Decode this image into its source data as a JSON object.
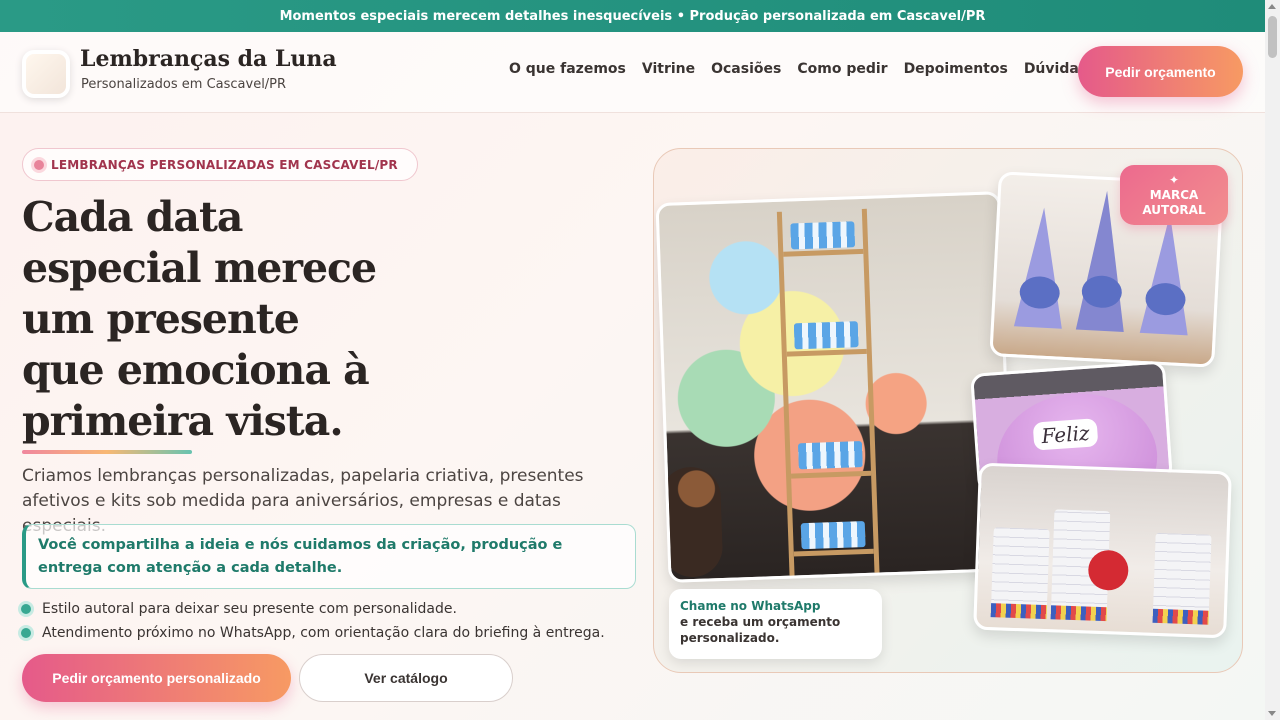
{
  "topbar": {
    "text": "Momentos especiais merecem detalhes inesquecíveis • Produção personalizada em Cascavel/PR"
  },
  "brand": {
    "name": "Lembranças da Luna",
    "subtitle": "Personalizados em Cascavel/PR"
  },
  "nav": {
    "items": [
      {
        "label": "O que fazemos"
      },
      {
        "label": "Vitrine"
      },
      {
        "label": "Ocasiões"
      },
      {
        "label": "Como pedir"
      },
      {
        "label": "Depoimentos"
      },
      {
        "label": "Dúvidas"
      }
    ],
    "cta_label": "Pedir orçamento"
  },
  "hero": {
    "pill_label": "LEMBRANÇAS PERSONALIZADAS EM CASCAVEL/PR",
    "headline_lines": [
      "Cada data",
      "especial merece",
      "um presente",
      "que emociona à",
      "primeira vista."
    ],
    "lead": "Criamos lembranças personalizadas, papelaria criativa, presentes afetivos e kits sob medida para aniversários, empresas e datas especiais.",
    "callout": "Você compartilha a ideia e nós cuidamos da criação, produção e entrega com atenção a cada detalhe.",
    "checks": [
      "Estilo autoral para deixar seu presente com personalidade.",
      "Atendimento próximo no WhatsApp, com orientação clara do briefing à entrega."
    ],
    "primary_button": "Pedir orçamento personalizado",
    "secondary_button": "Ver catálogo"
  },
  "gallery": {
    "badge_star": "✦",
    "badge_line1": "MARCA",
    "badge_line2": "AUTORAL",
    "feliz_text": "Feliz",
    "whatsapp_title": "Chame no WhatsApp",
    "whatsapp_text": "e receba um orçamento personalizado."
  },
  "colors": {
    "accent_teal": "#2a9a86",
    "gradient_pink": "#e55a8a",
    "gradient_orange": "#f79a63"
  }
}
